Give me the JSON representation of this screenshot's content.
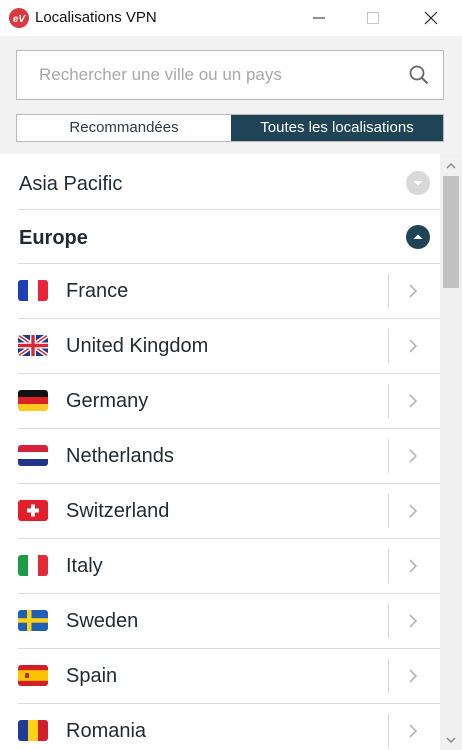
{
  "window": {
    "title": "Localisations VPN",
    "icons": [
      "expressvpn-logo",
      "minimize-icon",
      "maximize-icon",
      "close-icon"
    ]
  },
  "search": {
    "value": "",
    "placeholder": "Rechercher une ville ou un pays",
    "icon": "search-icon"
  },
  "tabs": [
    {
      "label": "Recommandées",
      "active": false
    },
    {
      "label": "Toutes les localisations",
      "active": true
    }
  ],
  "list": {
    "groups": [
      {
        "label": "Asia Pacific",
        "expanded": false,
        "icon": "chevron-down-icon"
      },
      {
        "label": "Europe",
        "expanded": true,
        "icon": "chevron-up-icon"
      }
    ],
    "countries": [
      {
        "label": "France",
        "flag": "flag-france"
      },
      {
        "label": "United Kingdom",
        "flag": "flag-united-kingdom"
      },
      {
        "label": "Germany",
        "flag": "flag-germany"
      },
      {
        "label": "Netherlands",
        "flag": "flag-netherlands"
      },
      {
        "label": "Switzerland",
        "flag": "flag-switzerland"
      },
      {
        "label": "Italy",
        "flag": "flag-italy"
      },
      {
        "label": "Sweden",
        "flag": "flag-sweden"
      },
      {
        "label": "Spain",
        "flag": "flag-spain"
      },
      {
        "label": "Romania",
        "flag": "flag-romania"
      }
    ]
  },
  "colors": {
    "accent": "#1f4456",
    "logo": "#da3940",
    "header_bg": "#f2f2f2",
    "collapsed_chevron_bg": "#d9d9d9"
  }
}
